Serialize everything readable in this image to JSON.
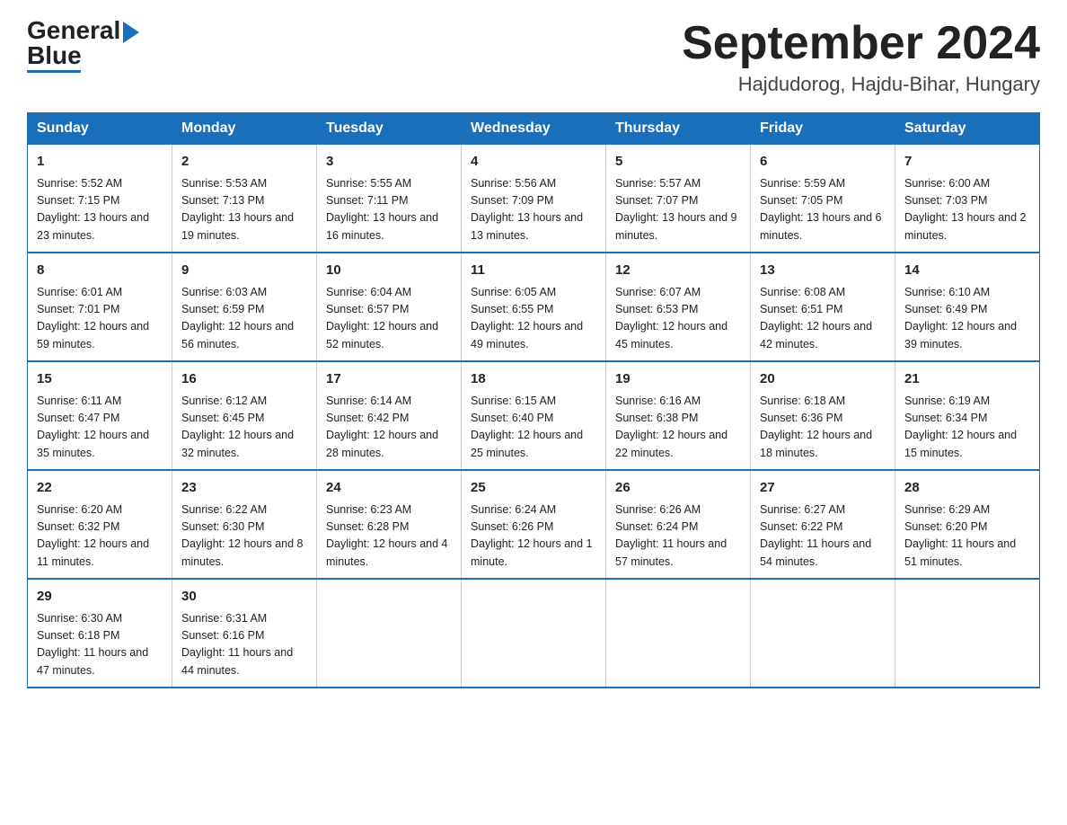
{
  "header": {
    "month_year": "September 2024",
    "location": "Hajdudorog, Hajdu-Bihar, Hungary"
  },
  "days_of_week": [
    "Sunday",
    "Monday",
    "Tuesday",
    "Wednesday",
    "Thursday",
    "Friday",
    "Saturday"
  ],
  "weeks": [
    [
      {
        "day": "1",
        "sunrise": "5:52 AM",
        "sunset": "7:15 PM",
        "daylight": "13 hours and 23 minutes."
      },
      {
        "day": "2",
        "sunrise": "5:53 AM",
        "sunset": "7:13 PM",
        "daylight": "13 hours and 19 minutes."
      },
      {
        "day": "3",
        "sunrise": "5:55 AM",
        "sunset": "7:11 PM",
        "daylight": "13 hours and 16 minutes."
      },
      {
        "day": "4",
        "sunrise": "5:56 AM",
        "sunset": "7:09 PM",
        "daylight": "13 hours and 13 minutes."
      },
      {
        "day": "5",
        "sunrise": "5:57 AM",
        "sunset": "7:07 PM",
        "daylight": "13 hours and 9 minutes."
      },
      {
        "day": "6",
        "sunrise": "5:59 AM",
        "sunset": "7:05 PM",
        "daylight": "13 hours and 6 minutes."
      },
      {
        "day": "7",
        "sunrise": "6:00 AM",
        "sunset": "7:03 PM",
        "daylight": "13 hours and 2 minutes."
      }
    ],
    [
      {
        "day": "8",
        "sunrise": "6:01 AM",
        "sunset": "7:01 PM",
        "daylight": "12 hours and 59 minutes."
      },
      {
        "day": "9",
        "sunrise": "6:03 AM",
        "sunset": "6:59 PM",
        "daylight": "12 hours and 56 minutes."
      },
      {
        "day": "10",
        "sunrise": "6:04 AM",
        "sunset": "6:57 PM",
        "daylight": "12 hours and 52 minutes."
      },
      {
        "day": "11",
        "sunrise": "6:05 AM",
        "sunset": "6:55 PM",
        "daylight": "12 hours and 49 minutes."
      },
      {
        "day": "12",
        "sunrise": "6:07 AM",
        "sunset": "6:53 PM",
        "daylight": "12 hours and 45 minutes."
      },
      {
        "day": "13",
        "sunrise": "6:08 AM",
        "sunset": "6:51 PM",
        "daylight": "12 hours and 42 minutes."
      },
      {
        "day": "14",
        "sunrise": "6:10 AM",
        "sunset": "6:49 PM",
        "daylight": "12 hours and 39 minutes."
      }
    ],
    [
      {
        "day": "15",
        "sunrise": "6:11 AM",
        "sunset": "6:47 PM",
        "daylight": "12 hours and 35 minutes."
      },
      {
        "day": "16",
        "sunrise": "6:12 AM",
        "sunset": "6:45 PM",
        "daylight": "12 hours and 32 minutes."
      },
      {
        "day": "17",
        "sunrise": "6:14 AM",
        "sunset": "6:42 PM",
        "daylight": "12 hours and 28 minutes."
      },
      {
        "day": "18",
        "sunrise": "6:15 AM",
        "sunset": "6:40 PM",
        "daylight": "12 hours and 25 minutes."
      },
      {
        "day": "19",
        "sunrise": "6:16 AM",
        "sunset": "6:38 PM",
        "daylight": "12 hours and 22 minutes."
      },
      {
        "day": "20",
        "sunrise": "6:18 AM",
        "sunset": "6:36 PM",
        "daylight": "12 hours and 18 minutes."
      },
      {
        "day": "21",
        "sunrise": "6:19 AM",
        "sunset": "6:34 PM",
        "daylight": "12 hours and 15 minutes."
      }
    ],
    [
      {
        "day": "22",
        "sunrise": "6:20 AM",
        "sunset": "6:32 PM",
        "daylight": "12 hours and 11 minutes."
      },
      {
        "day": "23",
        "sunrise": "6:22 AM",
        "sunset": "6:30 PM",
        "daylight": "12 hours and 8 minutes."
      },
      {
        "day": "24",
        "sunrise": "6:23 AM",
        "sunset": "6:28 PM",
        "daylight": "12 hours and 4 minutes."
      },
      {
        "day": "25",
        "sunrise": "6:24 AM",
        "sunset": "6:26 PM",
        "daylight": "12 hours and 1 minute."
      },
      {
        "day": "26",
        "sunrise": "6:26 AM",
        "sunset": "6:24 PM",
        "daylight": "11 hours and 57 minutes."
      },
      {
        "day": "27",
        "sunrise": "6:27 AM",
        "sunset": "6:22 PM",
        "daylight": "11 hours and 54 minutes."
      },
      {
        "day": "28",
        "sunrise": "6:29 AM",
        "sunset": "6:20 PM",
        "daylight": "11 hours and 51 minutes."
      }
    ],
    [
      {
        "day": "29",
        "sunrise": "6:30 AM",
        "sunset": "6:18 PM",
        "daylight": "11 hours and 47 minutes."
      },
      {
        "day": "30",
        "sunrise": "6:31 AM",
        "sunset": "6:16 PM",
        "daylight": "11 hours and 44 minutes."
      },
      {
        "day": "",
        "sunrise": "",
        "sunset": "",
        "daylight": ""
      },
      {
        "day": "",
        "sunrise": "",
        "sunset": "",
        "daylight": ""
      },
      {
        "day": "",
        "sunrise": "",
        "sunset": "",
        "daylight": ""
      },
      {
        "day": "",
        "sunrise": "",
        "sunset": "",
        "daylight": ""
      },
      {
        "day": "",
        "sunrise": "",
        "sunset": "",
        "daylight": ""
      }
    ]
  ],
  "logo": {
    "general": "General",
    "blue": "Blue"
  }
}
